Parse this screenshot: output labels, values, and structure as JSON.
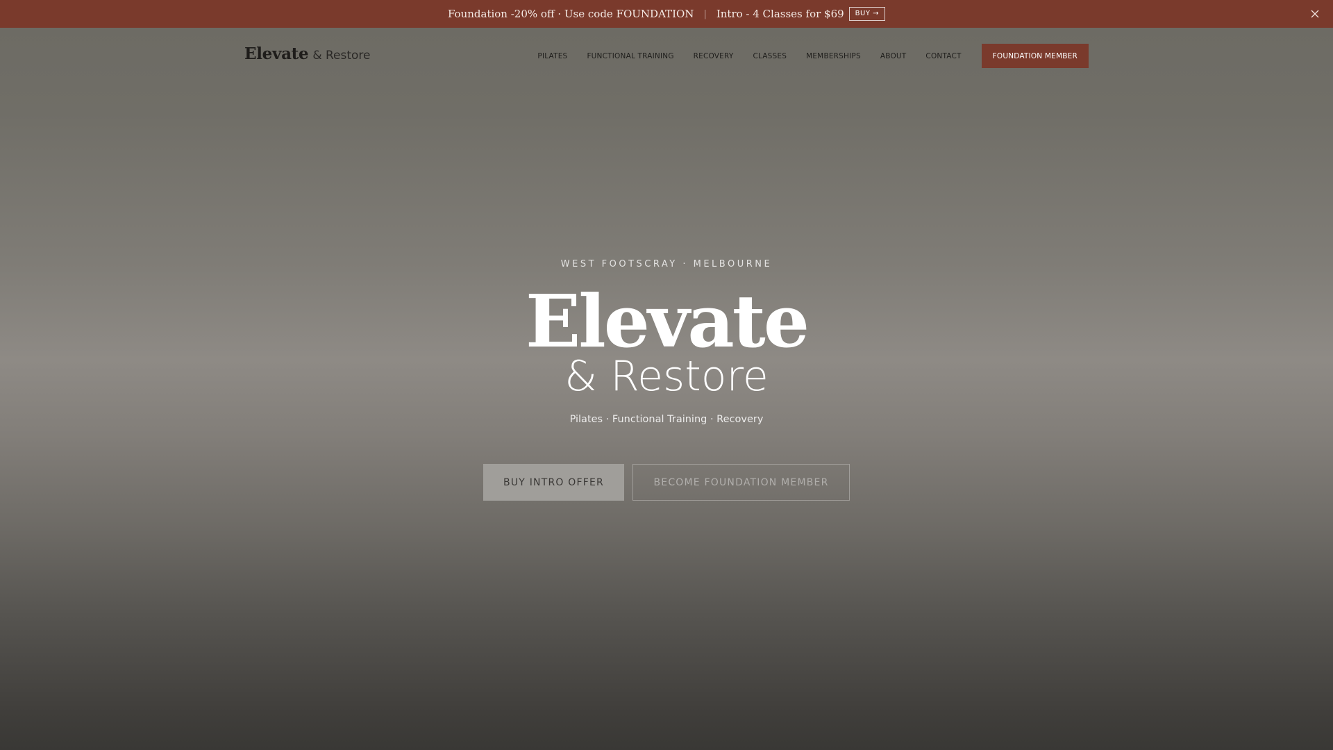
{
  "announcement": {
    "promo_1": "Foundation -20% off · Use code FOUNDATION",
    "separator": "|",
    "promo_2": "Intro - 4 Classes for $69",
    "buy_label": "BUY →",
    "close_icon": "close-icon",
    "background_color": "#7a3a2c"
  },
  "header": {
    "logo": {
      "main": "Elevate",
      "sub": "& Restore"
    },
    "nav": [
      {
        "label": "PILATES"
      },
      {
        "label": "FUNCTIONAL TRAINING"
      },
      {
        "label": "RECOVERY"
      },
      {
        "label": "CLASSES"
      },
      {
        "label": "MEMBERSHIPS"
      },
      {
        "label": "ABOUT"
      },
      {
        "label": "CONTACT"
      }
    ],
    "cta_label": "FOUNDATION MEMBER",
    "cta_color": "#7a3a2c"
  },
  "hero": {
    "eyebrow": "WEST FOOTSCRAY · MELBOURNE",
    "title_main": "Elevate",
    "title_sub": "& Restore",
    "tagline": "Pilates · Functional Training · Recovery",
    "primary_button": "BUY INTRO OFFER",
    "secondary_button": "BECOME FOUNDATION MEMBER"
  }
}
